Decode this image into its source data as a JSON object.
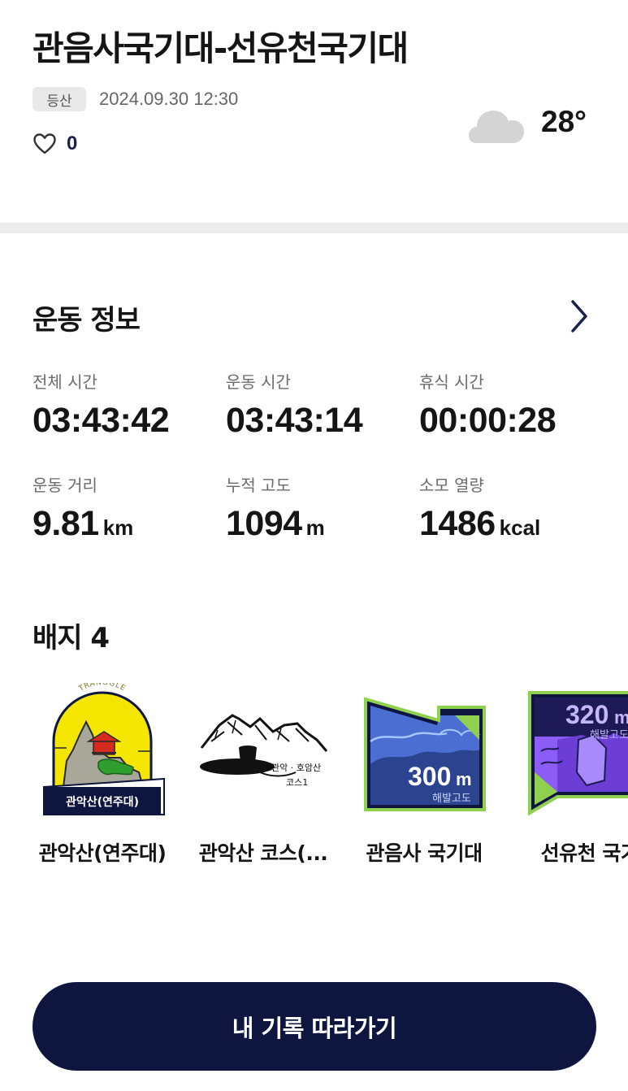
{
  "header": {
    "title": "관음사국기대-선유천국기대",
    "activity_tag": "등산",
    "datetime": "2024.09.30 12:30",
    "like_count": "0",
    "weather_icon": "cloud-icon",
    "temperature": "28°"
  },
  "exercise": {
    "section_title": "운동 정보",
    "stats": [
      {
        "label": "전체 시간",
        "value": "03:43:42",
        "unit": ""
      },
      {
        "label": "운동 시간",
        "value": "03:43:14",
        "unit": ""
      },
      {
        "label": "휴식 시간",
        "value": "00:00:28",
        "unit": ""
      },
      {
        "label": "운동 거리",
        "value": "9.81",
        "unit": "km"
      },
      {
        "label": "누적 고도",
        "value": "1094",
        "unit": "m"
      },
      {
        "label": "소모 열량",
        "value": "1486",
        "unit": "kcal"
      }
    ]
  },
  "badges": {
    "section_title": "배지 4",
    "items": [
      {
        "label": "관악산(연주대)",
        "art_banner": "관악산(연주대)",
        "art_arc": "TRANGGLE"
      },
      {
        "label": "관악산 코스(...",
        "art_caption": "관악 · 호암산",
        "art_caption2": "코스1"
      },
      {
        "label": "관음사 국기대",
        "art_value": "300",
        "art_unit": "m",
        "art_sub": "해발고도"
      },
      {
        "label": "선유천 국기",
        "art_value": "320",
        "art_unit": "m",
        "art_sub": "해발고도"
      }
    ]
  },
  "cta": {
    "label": "내 기록 따라가기"
  },
  "colors": {
    "navy": "#0e1640",
    "badge_green": "#8fd14f",
    "badge_purple": "#8b5cf6",
    "badge_yellow": "#f4e600"
  }
}
